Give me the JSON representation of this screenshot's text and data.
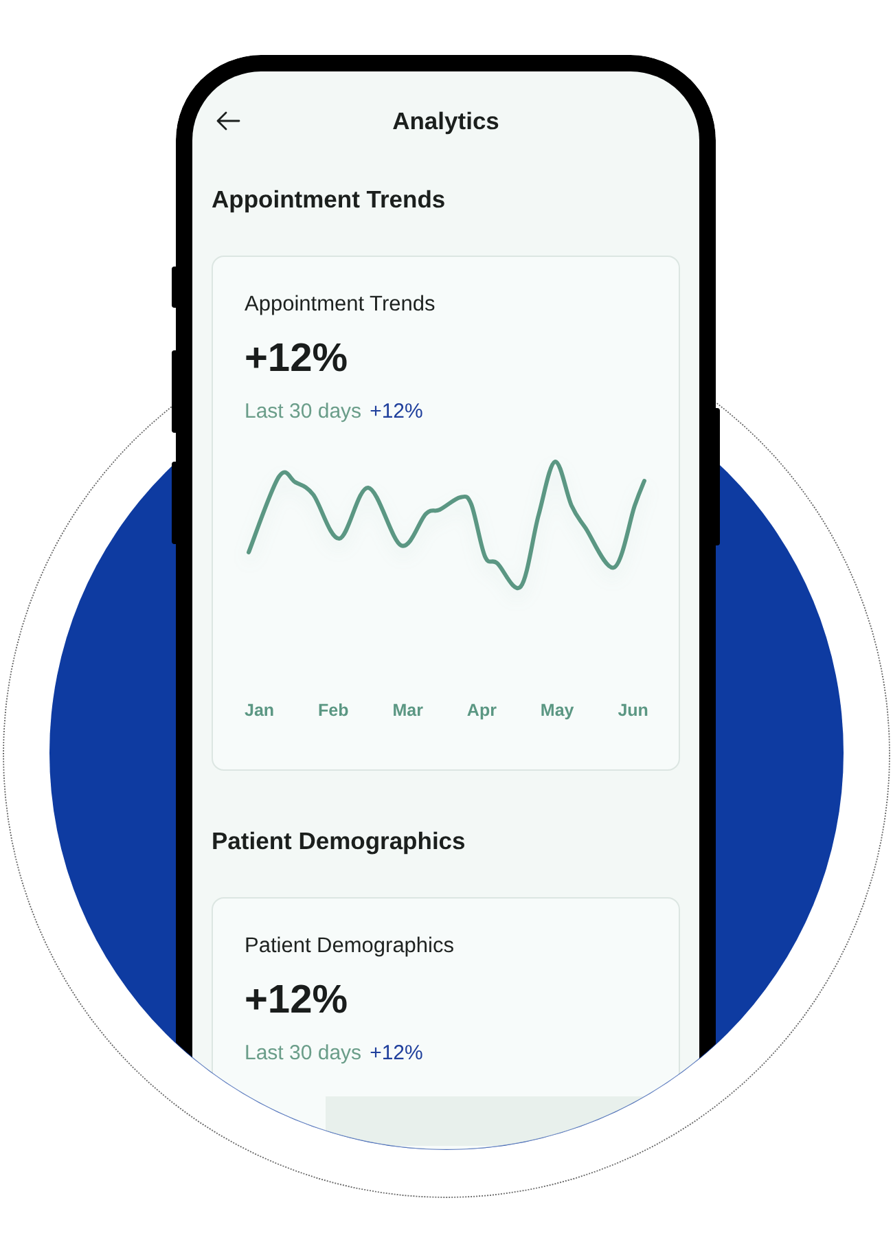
{
  "header": {
    "title": "Analytics"
  },
  "sections": [
    {
      "heading": "Appointment Trends",
      "card": {
        "title": "Appointment Trends",
        "value": "+12%",
        "period": "Last 30 days",
        "change": "+12%",
        "chart": {
          "kind": "line",
          "x_labels": [
            "Jan",
            "Feb",
            "Mar",
            "Apr",
            "May",
            "Jun"
          ]
        }
      }
    },
    {
      "heading": "Patient Demographics",
      "card": {
        "title": "Patient Demographics",
        "value": "+12%",
        "period": "Last 30 days",
        "change": "+12%",
        "chart": {
          "kind": "panel"
        }
      }
    }
  ]
}
